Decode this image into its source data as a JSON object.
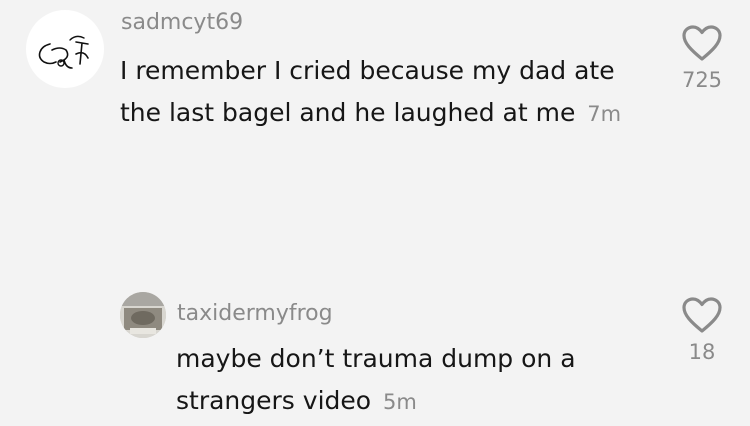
{
  "comments": [
    {
      "username": "sadmcyt69",
      "avatar": "doodle-avatar",
      "text": "I remember I cried because my dad ate the last bagel and he laughed at me",
      "time": "7m",
      "likes": "725",
      "like_icon": "heart-outline-icon"
    },
    {
      "username": "taxidermyfrog",
      "avatar": "photo-avatar",
      "text": "maybe don’t trauma dump on a strangers video",
      "time": "5m",
      "likes": "18",
      "like_icon": "heart-outline-icon"
    }
  ],
  "colors": {
    "background": "#f3f3f3",
    "text": "#161616",
    "secondary_text": "#8a8a8a",
    "icon": "#8a8a8a"
  }
}
